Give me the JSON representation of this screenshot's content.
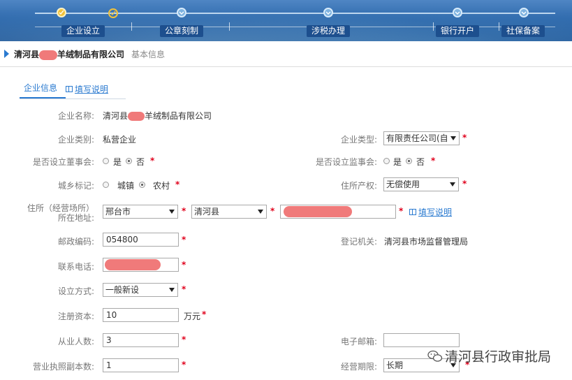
{
  "progress": {
    "steps": [
      {
        "label": "企业设立",
        "state": "current"
      },
      {
        "label": "公章刻制",
        "state": "upcoming"
      },
      {
        "label": "涉税办理",
        "state": "upcoming"
      },
      {
        "label": "银行开户",
        "state": "upcoming"
      },
      {
        "label": "社保备案",
        "state": "upcoming"
      }
    ]
  },
  "header": {
    "company_name_prefix": "清河县",
    "company_name_suffix": "羊绒制品有限公司",
    "subtitle": "基本信息"
  },
  "tabs": {
    "active": "企业信息",
    "help_link": "填写说明"
  },
  "form": {
    "name": {
      "label": "企业名称:",
      "prefix": "清河县",
      "suffix": "羊绒制品有限公司"
    },
    "category": {
      "label": "企业类别:",
      "value": "私营企业"
    },
    "type": {
      "label": "企业类型:",
      "value": "有限责任公司(自"
    },
    "board": {
      "label": "是否设立董事会:",
      "yes": "是",
      "no": "否",
      "selected": "否"
    },
    "supervisory": {
      "label": "是否设立监事会:",
      "yes": "是",
      "no": "否",
      "selected": "否"
    },
    "urban_rural": {
      "label": "城乡标记:",
      "option1": "城镇",
      "option2": "农村",
      "selected": "农村"
    },
    "property_right": {
      "label": "住所产权:",
      "value": "无偿使用"
    },
    "address": {
      "label_line1": "住所（经营场所）",
      "label_line2": "所在地址:",
      "city": "邢台市",
      "county": "清河县",
      "help_link": "填写说明"
    },
    "postcode": {
      "label": "邮政编码:",
      "value": "054800"
    },
    "authority": {
      "label": "登记机关:",
      "value": "清河县市场监督管理局"
    },
    "phone": {
      "label": "联系电话:"
    },
    "establish_mode": {
      "label": "设立方式:",
      "value": "一般新设"
    },
    "capital": {
      "label": "注册资本:",
      "value": "10",
      "unit": "万元"
    },
    "employees": {
      "label": "从业人数:",
      "value": "3"
    },
    "email": {
      "label": "电子邮箱:",
      "value": ""
    },
    "license_copies": {
      "label": "营业执照副本数:",
      "value": "1"
    },
    "term": {
      "label": "经营期限:",
      "value": "长期"
    },
    "required_mark": "*"
  },
  "watermark": {
    "text": "清河县行政审批局"
  },
  "colors": {
    "accent": "#2a7ad0",
    "required": "#e0001b",
    "banner": "#2f6aad",
    "active_step": "#f2c23a"
  }
}
